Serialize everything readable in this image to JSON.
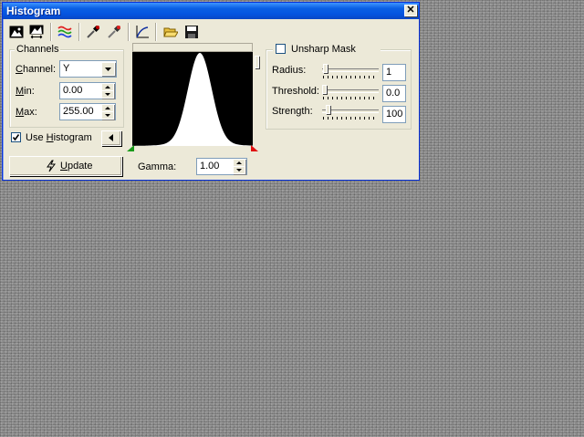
{
  "window": {
    "title": "Histogram"
  },
  "channels": {
    "legend": "Channels",
    "channel_label_u": "C",
    "channel_label_rest": "hannel:",
    "channel_value": "Y",
    "min_label_u": "M",
    "min_label_rest": "in:",
    "min_value": "0.00",
    "max_label_u": "M",
    "max_label_rest": "ax:",
    "max_value": "255.00"
  },
  "use_histogram": {
    "label_pre": "Use ",
    "label_u": "H",
    "label_rest": "istogram",
    "checked": true
  },
  "update_button": {
    "label_u": "U",
    "label_rest": "pdate"
  },
  "gamma": {
    "label": "Gamma:",
    "value": "1.00"
  },
  "unsharp": {
    "label": "Unsharp Mask",
    "checked": false,
    "radius": {
      "label": "Radius:",
      "value": "1",
      "level": 0.02
    },
    "threshold": {
      "label": "Threshold:",
      "value": "0.0",
      "level": 0.0
    },
    "strength": {
      "label": "Strength:",
      "value": "100",
      "level": 0.07
    }
  },
  "icons": [
    "image-icon",
    "image-arrows-icon",
    "color-waves-icon",
    "eyedropper-black-icon",
    "eyedropper-red-icon",
    "curve-icon",
    "open-folder-icon",
    "save-disk-icon",
    "play-left-icon",
    "lightning-icon"
  ],
  "colors": {
    "titlebar": "#0a5fe4",
    "window": "#ece9d8",
    "histogram_bg": "#000000",
    "histogram_fill": "#ffffff"
  }
}
